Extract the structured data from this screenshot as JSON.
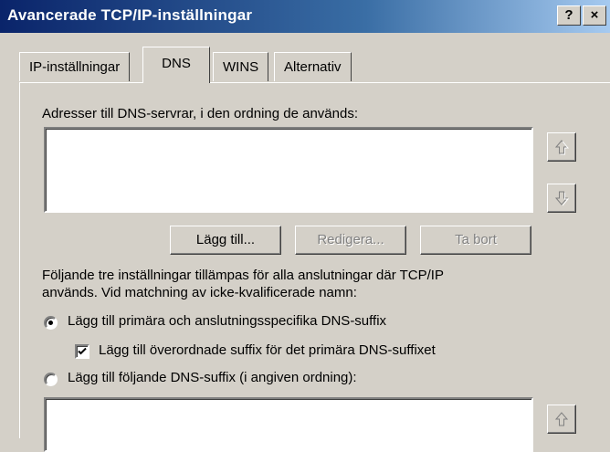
{
  "window": {
    "title": "Avancerade TCP/IP-inställningar",
    "help_label": "?",
    "close_label": "×"
  },
  "tabs": [
    {
      "label": "IP-inställningar"
    },
    {
      "label": "DNS"
    },
    {
      "label": "WINS"
    },
    {
      "label": "Alternativ"
    }
  ],
  "dns": {
    "servers_label": "Adresser till DNS-servrar, i den ordning de används:",
    "add_button": "Lägg till...",
    "edit_button": "Redigera...",
    "remove_button": "Ta bort",
    "description": "Följande tre inställningar tillämpas för alla anslutningar där TCP/IP",
    "description2": "används. Vid matchning av icke-kvalificerade namn:",
    "radio_primary": "Lägg till primära och anslutningsspecifika DNS-suffix",
    "check_parent": "Lägg till överordnade suffix för det primära DNS-suffixet",
    "radio_following": "Lägg till följande DNS-suffix (i angiven ordning):"
  },
  "state": {
    "radio_primary_selected": true,
    "check_parent_checked": true,
    "radio_following_selected": false
  },
  "icons": [
    "arrow-up-icon",
    "arrow-down-icon",
    "check-icon"
  ]
}
